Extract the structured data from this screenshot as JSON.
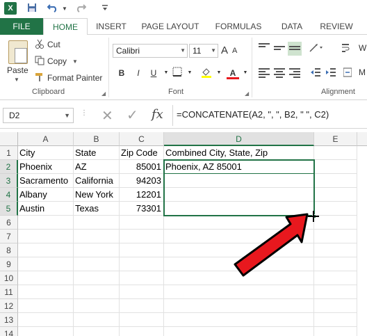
{
  "quick_access": {
    "app_icon": "X",
    "save_icon": "save-icon",
    "undo_icon": "undo-icon",
    "redo_icon": "redo-icon",
    "customize_icon": "customize-icon"
  },
  "tabs": [
    "FILE",
    "HOME",
    "INSERT",
    "PAGE LAYOUT",
    "FORMULAS",
    "DATA",
    "REVIEW"
  ],
  "ribbon": {
    "clipboard": {
      "paste_label": "Paste",
      "cut_label": "Cut",
      "copy_label": "Copy",
      "format_painter_label": "Format Painter",
      "group_label": "Clipboard"
    },
    "font": {
      "font_name": "Calibri",
      "font_size": "11",
      "bold": "B",
      "italic": "I",
      "underline": "U",
      "grow": "A",
      "shrink": "A",
      "font_color": "A",
      "group_label": "Font"
    },
    "alignment": {
      "wrap_label": "W",
      "merge_label": "M",
      "group_label": "Alignment"
    }
  },
  "formula_bar": {
    "name_box": "D2",
    "formula": "=CONCATENATE(A2, \", \", B2, \" \", C2)",
    "fx_label": "fx",
    "cancel_symbol": "✕",
    "enter_symbol": "✓"
  },
  "sheet": {
    "columns": [
      "A",
      "B",
      "C",
      "D",
      "E"
    ],
    "rows": [
      "1",
      "2",
      "3",
      "4",
      "5",
      "6",
      "7",
      "8",
      "9",
      "10",
      "11",
      "12",
      "13",
      "14"
    ],
    "cells": {
      "A1": "City",
      "B1": "State",
      "C1": "Zip Code",
      "D1": "Combined City, State, Zip",
      "A2": "Phoenix",
      "B2": "AZ",
      "C2": "85001",
      "D2": "Phoenix, AZ 85001",
      "A3": "Sacramento",
      "B3": "California",
      "C3": "94203",
      "A4": "Albany",
      "B4": "New York",
      "C4": "12201",
      "A5": "Austin",
      "B5": "Texas",
      "C5": "73301"
    },
    "active_cell": "D2",
    "selection": "D2:D5"
  },
  "colors": {
    "excel_green": "#217346",
    "arrow_red": "#e8181e"
  }
}
